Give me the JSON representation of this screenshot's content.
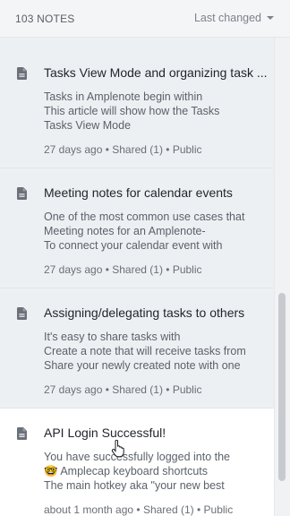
{
  "header": {
    "count_label": "103 NOTES",
    "sort_label": "Last changed"
  },
  "notes": [
    {
      "title": "Tasks View Mode and organizing task ...",
      "lines": [
        "Tasks in Amplenote begin within",
        "This article will show how the Tasks",
        "Tasks View Mode"
      ],
      "meta": "27 days ago • Shared (1) • Public"
    },
    {
      "title": "Meeting notes for calendar events",
      "lines": [
        "One of the most common use cases that",
        "Meeting notes for an Amplenote-",
        "To connect your calendar event with"
      ],
      "meta": "27 days ago • Shared (1) • Public"
    },
    {
      "title": "Assigning/delegating tasks to others",
      "lines": [
        "It's easy to share tasks with",
        "Create a note that will receive tasks from",
        "Share your newly created note with one"
      ],
      "meta": "27 days ago • Shared (1) • Public"
    },
    {
      "title": "API Login Successful!",
      "lines": [
        "You have successfully logged into the",
        "🤓 Amplecap keyboard shortcuts",
        "The main hotkey aka \"your new best"
      ],
      "meta": "about 1 month ago • Shared (1) • Public"
    }
  ]
}
